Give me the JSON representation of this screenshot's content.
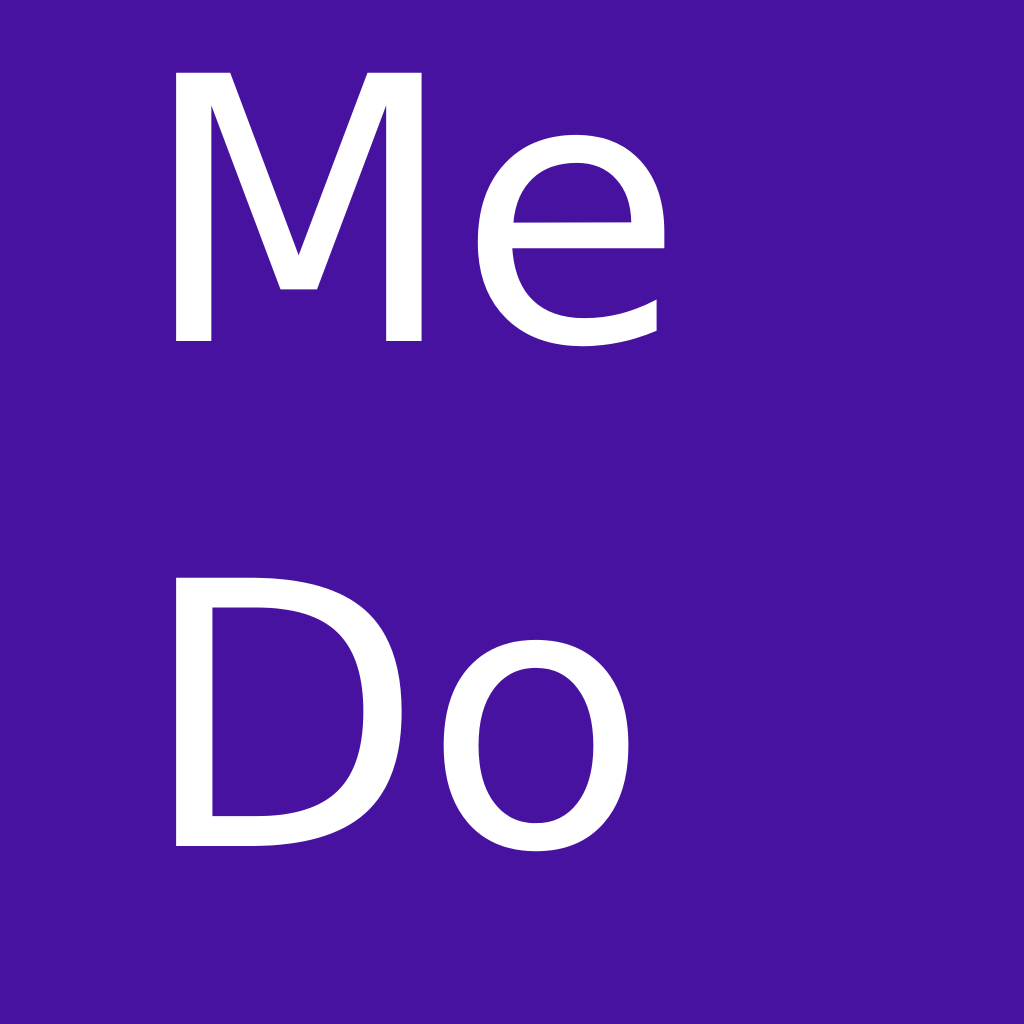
{
  "tile": {
    "background_color": "#4712a0",
    "text_color": "#ffffff",
    "line1": "Me",
    "line2": "Do"
  }
}
